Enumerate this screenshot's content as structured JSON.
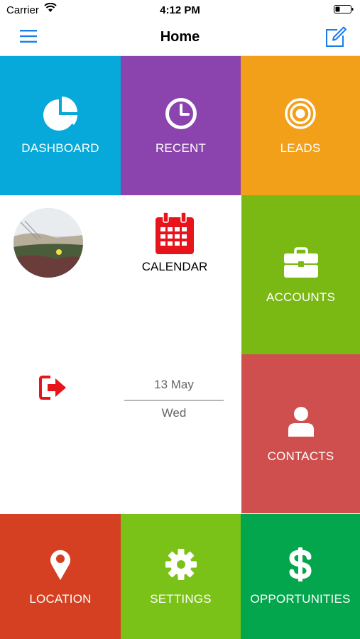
{
  "status_bar": {
    "carrier": "Carrier",
    "time": "4:12 PM"
  },
  "nav": {
    "title": "Home",
    "menu_icon": "hamburger-menu-icon",
    "edit_icon": "compose-icon",
    "accent": "#1a7ee6"
  },
  "tiles": {
    "dashboard": {
      "label": "DASHBOARD",
      "icon": "pie-chart-icon",
      "color": "#06a9d9"
    },
    "recent": {
      "label": "RECENT",
      "icon": "clock-icon",
      "color": "#8b44ad"
    },
    "leads": {
      "label": "LEADS",
      "icon": "target-icon",
      "color": "#f2a01a"
    },
    "accounts": {
      "label": "ACCOUNTS",
      "icon": "briefcase-icon",
      "color": "#7ab814"
    },
    "contacts": {
      "label": "CONTACTS",
      "icon": "person-icon",
      "color": "#cf4f4f"
    },
    "location": {
      "label": "LOCATION",
      "icon": "map-pin-icon",
      "color": "#d64022"
    },
    "settings": {
      "label": "SETTINGS",
      "icon": "gear-icon",
      "color": "#7bc218"
    },
    "opportunities": {
      "label": "OPPORTUNITIES",
      "icon": "dollar-icon",
      "color": "#03a64c"
    }
  },
  "calendar": {
    "label": "CALENDAR",
    "icon": "calendar-icon",
    "color": "#e8141b"
  },
  "logout": {
    "icon": "logout-icon",
    "color": "#e8141b"
  },
  "date": {
    "day": "13 May",
    "weekday": "Wed"
  }
}
